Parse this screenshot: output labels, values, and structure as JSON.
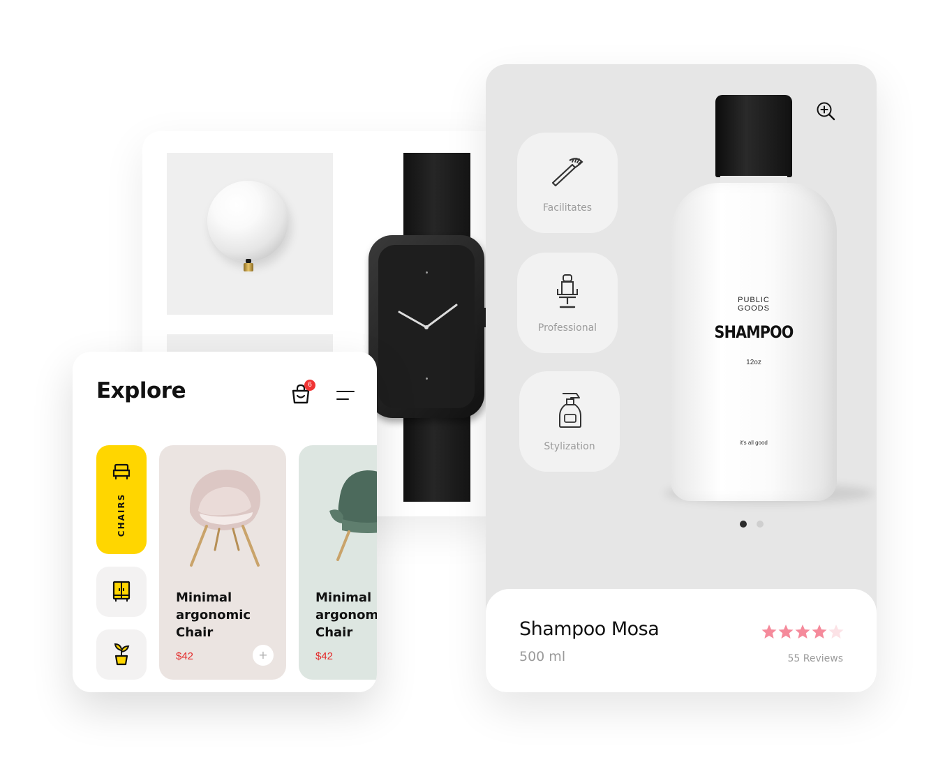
{
  "explore": {
    "title": "Explore",
    "cart_count": "6",
    "categories": [
      {
        "label": "CHAIRS",
        "icon": "armchair-icon",
        "active": true
      },
      {
        "label": "",
        "icon": "wardrobe-icon",
        "active": false
      },
      {
        "label": "",
        "icon": "plant-pot-icon",
        "active": false
      }
    ],
    "products": [
      {
        "name": "Minimal argonomic Chair",
        "price": "$42"
      },
      {
        "name": "Minimal argonomic Chair",
        "price": "$42"
      }
    ],
    "accent_color": "#ffd600",
    "price_color": "#e32b2b"
  },
  "shampoo": {
    "features": [
      {
        "label": "Facilitates",
        "icon": "comb-icon"
      },
      {
        "label": "Professional",
        "icon": "barber-chair-icon"
      },
      {
        "label": "Stylization",
        "icon": "spray-bottle-icon"
      }
    ],
    "bottle": {
      "brand_line1": "PUBLIC",
      "brand_line2": "GOODS",
      "title": "SHAMPOO",
      "size": "12oz",
      "tagline": "it's all good"
    },
    "carousel": {
      "current": 1,
      "total": 2
    },
    "product_name": "Shampoo Mosa",
    "volume": "500 ml",
    "rating": 4,
    "rating_max": 5,
    "reviews": "55 Reviews",
    "star_color": "#f58a9b"
  }
}
